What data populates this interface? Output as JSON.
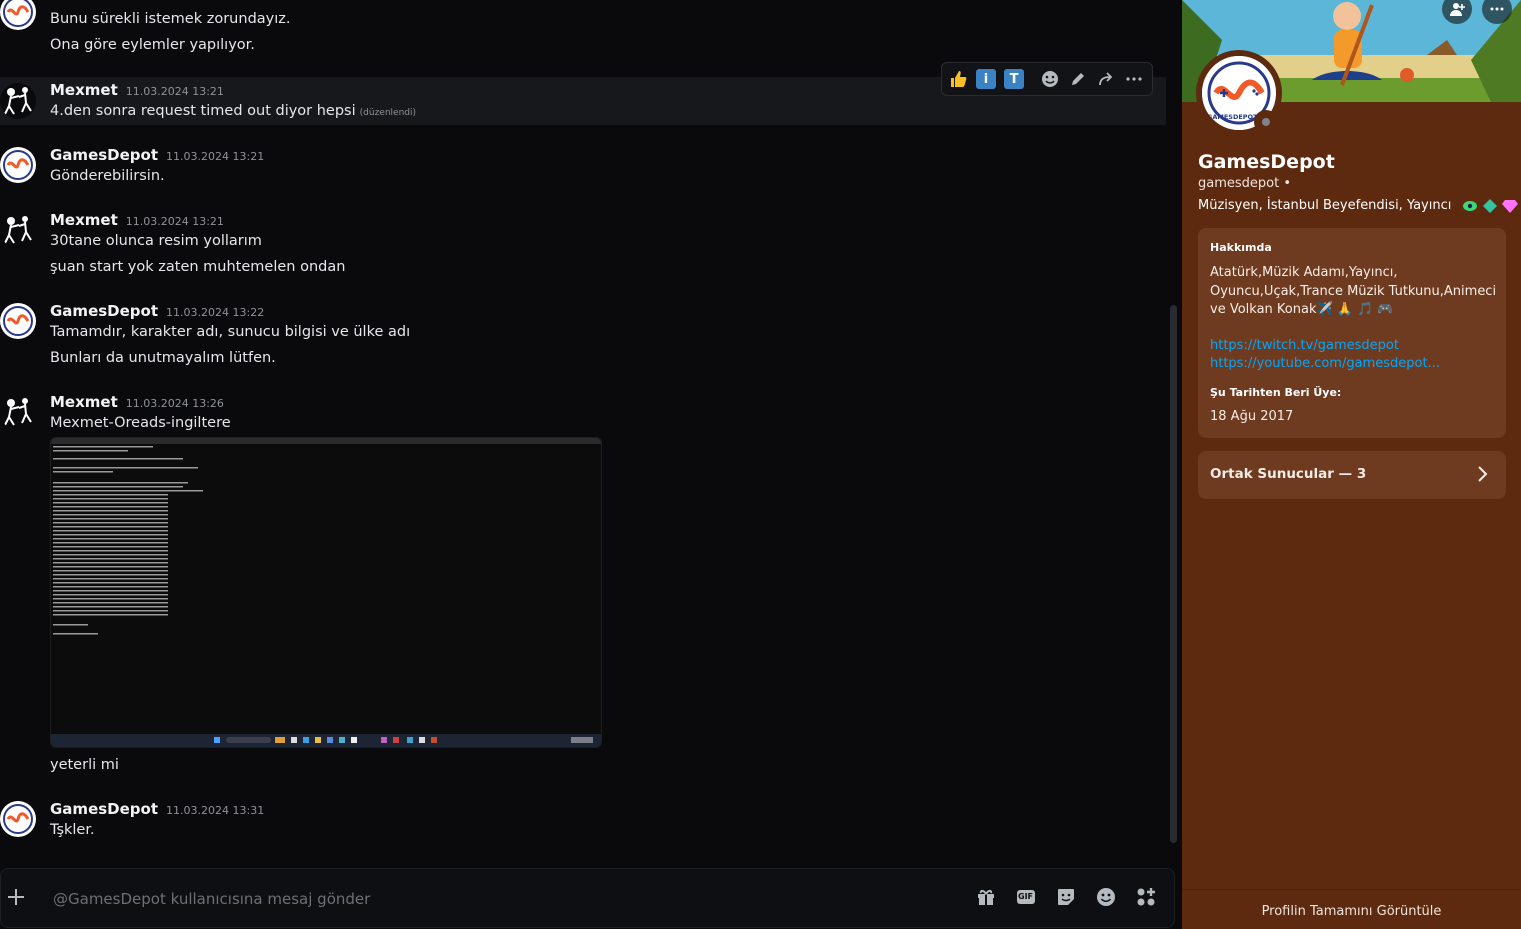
{
  "messages": {
    "m0": {
      "line1": "Bunu sürekli istemek zorundayız.",
      "line2": "Ona göre eylemler yapılıyor."
    },
    "m1": {
      "author": "Mexmet",
      "time": "11.03.2024 13:21",
      "line1": "4.den sonra request timed out diyor hepsi",
      "edited": "(düzenlendi)"
    },
    "m2": {
      "author": "GamesDepot",
      "time": "11.03.2024 13:21",
      "line1": "Gönderebilirsin."
    },
    "m3": {
      "author": "Mexmet",
      "time": "11.03.2024 13:21",
      "line1": "30tane olunca resim yollarım",
      "line2": "şuan start yok zaten muhtemelen ondan"
    },
    "m4": {
      "author": "GamesDepot",
      "time": "11.03.2024 13:22",
      "line1": "Tamamdır, karakter adı, sunucu bilgisi ve ülke adı",
      "line2": "Bunları da unutmayalım lütfen."
    },
    "m5": {
      "author": "Mexmet",
      "time": "11.03.2024 13:26",
      "line1": "Mexmet-Oreads-ingiltere",
      "after": "yeterli mi"
    },
    "m6": {
      "author": "GamesDepot",
      "time": "11.03.2024 13:31",
      "line1": "Tşkler."
    }
  },
  "toolbar": {
    "info_label": "i",
    "translate_label": "T"
  },
  "composer": {
    "placeholder": "@GamesDepot kullanıcısına mesaj gönder",
    "gif_label": "GIF"
  },
  "profile": {
    "name": "GamesDepot",
    "handle": "gamesdepot •",
    "tags": "Müzisyen, İstanbul Beyefendisi, Yayıncı",
    "about_heading": "Hakkımda",
    "about_text": "Atatürk,Müzik Adamı,Yayıncı, Oyuncu,Uçak,Trance Müzik Tutkunu,Animeci ve Volkan Konak✈️ 🙏 🎵 🎮",
    "links": [
      "https://twitch.tv/gamesdepot",
      "https://youtube.com/gamesdepot..."
    ],
    "member_since_heading": "Şu Tarihten Beri Üye:",
    "member_since": "18 Ağu 2017",
    "mutual_servers": "Ortak Sunucular — 3",
    "footer": "Profilin Tamamını Görüntüle",
    "avatar_text": "GAMESDEPOT"
  },
  "colors": {
    "profile_bg": "#5d2a0f",
    "card_bg": "#6e3a20",
    "link": "#00a8fc",
    "chat_bg": "#0a0a0c"
  }
}
